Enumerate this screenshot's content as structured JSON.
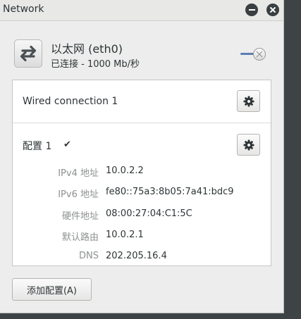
{
  "window": {
    "title": "Network"
  },
  "device": {
    "icon": "network-transfer-icon",
    "name": "以太网 (eth0)",
    "status": "已连接 - 1000 Mb/秒",
    "enabled": true
  },
  "connection": {
    "name": "Wired connection 1"
  },
  "profile": {
    "name": "配置 1",
    "check": "✔",
    "rows": [
      {
        "label": "IPv4 地址",
        "value": "10.0.2.2"
      },
      {
        "label": "IPv6 地址",
        "value": "fe80::75a3:8b05:7a41:bdc9"
      },
      {
        "label": "硬件地址",
        "value": "08:00:27:04:C1:5C"
      },
      {
        "label": "默认路由",
        "value": "10.0.2.1"
      },
      {
        "label": "DNS",
        "value": "202.205.16.4"
      }
    ]
  },
  "actions": {
    "add_profile": "添加配置(A)"
  }
}
